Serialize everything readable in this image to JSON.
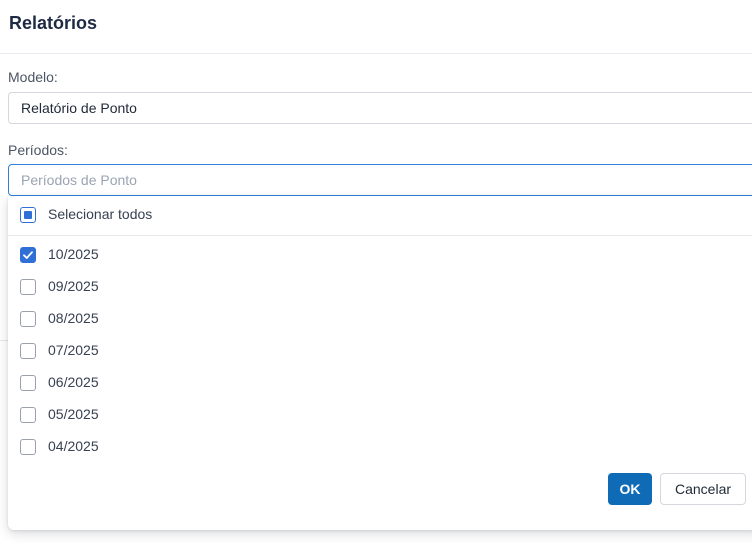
{
  "header": {
    "title": "Relatórios"
  },
  "modelo": {
    "label": "Modelo:",
    "value": "Relatório de Ponto"
  },
  "periodos": {
    "label": "Períodos:",
    "placeholder": "Períodos de Ponto",
    "select_all": {
      "label": "Selecionar todos",
      "state": "partial"
    },
    "options": [
      {
        "label": "10/2025",
        "checked": true
      },
      {
        "label": "09/2025",
        "checked": false
      },
      {
        "label": "08/2025",
        "checked": false
      },
      {
        "label": "07/2025",
        "checked": false
      },
      {
        "label": "06/2025",
        "checked": false
      },
      {
        "label": "05/2025",
        "checked": false
      },
      {
        "label": "04/2025",
        "checked": false
      }
    ]
  },
  "actions": {
    "ok_label": "OK",
    "cancel_label": "Cancelar"
  },
  "colors": {
    "primary": "#0f6bb5",
    "checkbox_accent": "#2f6fd6",
    "focus_border": "#2f7fd9"
  }
}
